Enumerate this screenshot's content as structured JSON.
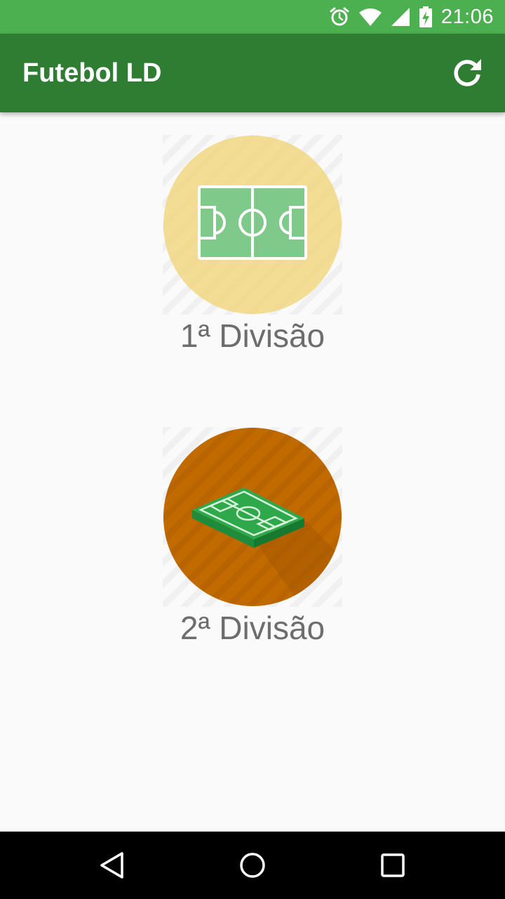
{
  "status_bar": {
    "time": "21:06",
    "icons": [
      "alarm-icon",
      "wifi-icon",
      "signal-icon",
      "battery-charging-icon"
    ],
    "color": "#4caf50"
  },
  "app_bar": {
    "title": "Futebol LD",
    "action_icon": "refresh-icon",
    "color": "#2e7d32"
  },
  "divisions": [
    {
      "label": "1ª Divisão",
      "icon": "soccer-field-top-view-icon",
      "badge_color": "#f2d67e"
    },
    {
      "label": "2ª Divisão",
      "icon": "soccer-field-3d-icon",
      "badge_color": "#c16a00"
    }
  ],
  "nav_bar": {
    "icons": [
      "back-icon",
      "home-icon",
      "recents-icon"
    ]
  }
}
